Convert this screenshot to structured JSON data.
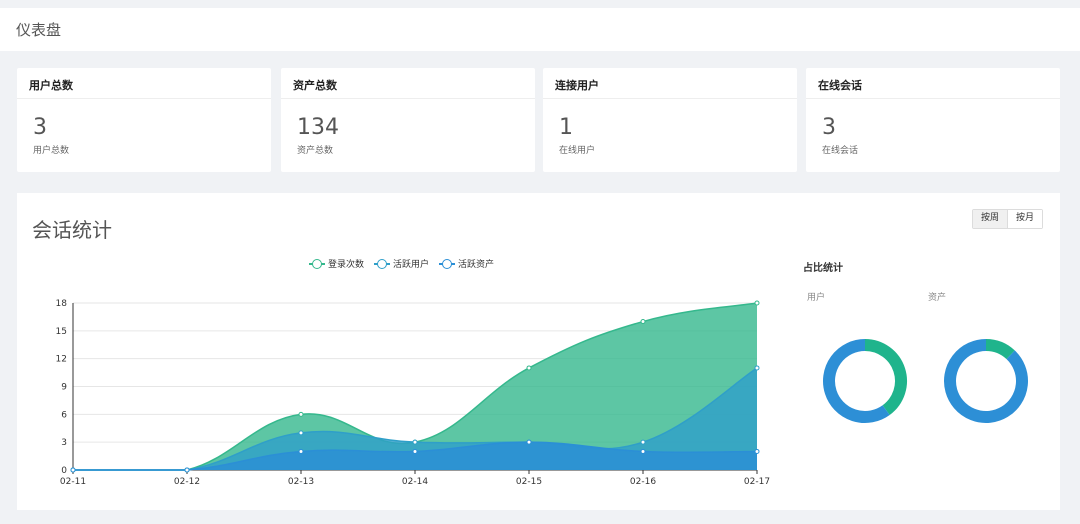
{
  "page": {
    "title": "仪表盘"
  },
  "cards": [
    {
      "title": "用户总数",
      "value": "3",
      "sub": "用户总数"
    },
    {
      "title": "资产总数",
      "value": "134",
      "sub": "资产总数"
    },
    {
      "title": "连接用户",
      "value": "1",
      "sub": "在线用户"
    },
    {
      "title": "在线会话",
      "value": "3",
      "sub": "在线会话"
    }
  ],
  "session_panel": {
    "title": "会话统计",
    "toggle": [
      "按周",
      "按月"
    ],
    "active_toggle": "按周"
  },
  "ratio": {
    "title": "占比统计",
    "user_label": "用户",
    "asset_label": "资产"
  },
  "colors": {
    "login": "#35b88d",
    "active_user": "#2f9fc9",
    "active_asset": "#2b8fd6"
  },
  "chart_data": [
    {
      "type": "area",
      "categories": [
        "02-11",
        "02-12",
        "02-13",
        "02-14",
        "02-15",
        "02-16",
        "02-17"
      ],
      "ylim": [
        0,
        18
      ],
      "yticks": [
        "0",
        "3",
        "6",
        "9",
        "12",
        "15",
        "18"
      ],
      "series": [
        {
          "name": "登录次数",
          "values": [
            0,
            0,
            6,
            3,
            11,
            16,
            18
          ]
        },
        {
          "name": "活跃用户",
          "values": [
            0,
            0,
            4,
            3,
            3,
            3,
            11
          ]
        },
        {
          "name": "活跃资产",
          "values": [
            0,
            0,
            2,
            2,
            3,
            2,
            2
          ]
        }
      ],
      "legend": "top-center",
      "grid": true
    },
    {
      "type": "pie",
      "title": "用户",
      "values": [
        40,
        60
      ]
    },
    {
      "type": "pie",
      "title": "资产",
      "values": [
        12,
        88
      ]
    }
  ]
}
